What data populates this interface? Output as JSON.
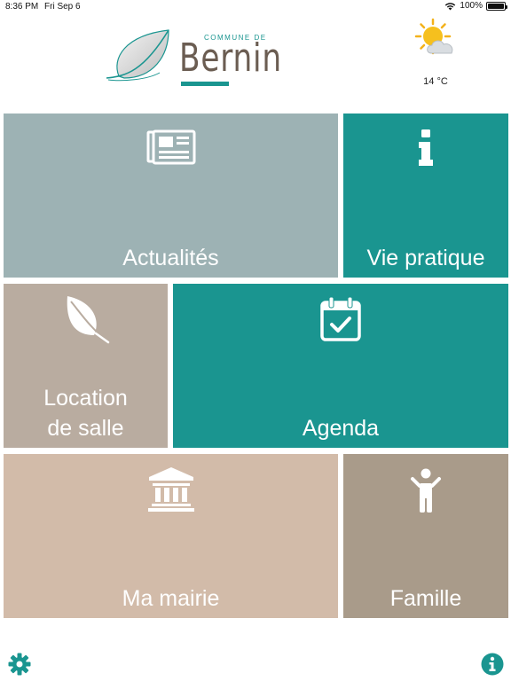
{
  "status_bar": {
    "time": "8:36 PM",
    "date": "Fri Sep 6",
    "battery": "100%",
    "wifi_icon": "wifi-icon",
    "battery_icon": "battery-icon"
  },
  "header": {
    "logo_commune": "COMMUNE DE",
    "logo_name": "Bernin",
    "logo_icon": "leaf-logo-icon",
    "weather_icon": "sun-cloud-icon",
    "temperature": "14 °C"
  },
  "tiles": [
    {
      "label": "Actualités",
      "icon": "newspaper-icon",
      "color": "#9db2b4"
    },
    {
      "label": "Vie pratique",
      "icon": "info-icon",
      "color": "#1a9590"
    },
    {
      "label_line1": "Location",
      "label_line2": "de salle",
      "icon": "leaf-icon",
      "color": "#b9aca0"
    },
    {
      "label": "Agenda",
      "icon": "calendar-check-icon",
      "color": "#1a9590"
    },
    {
      "label": "Ma mairie",
      "icon": "town-hall-icon",
      "color": "#d2bba9"
    },
    {
      "label": "Famille",
      "icon": "child-icon",
      "color": "#a99b8a"
    }
  ],
  "footer": {
    "settings_icon": "gear-icon",
    "info_icon": "info-circle-icon",
    "accent": "#1a9590"
  }
}
